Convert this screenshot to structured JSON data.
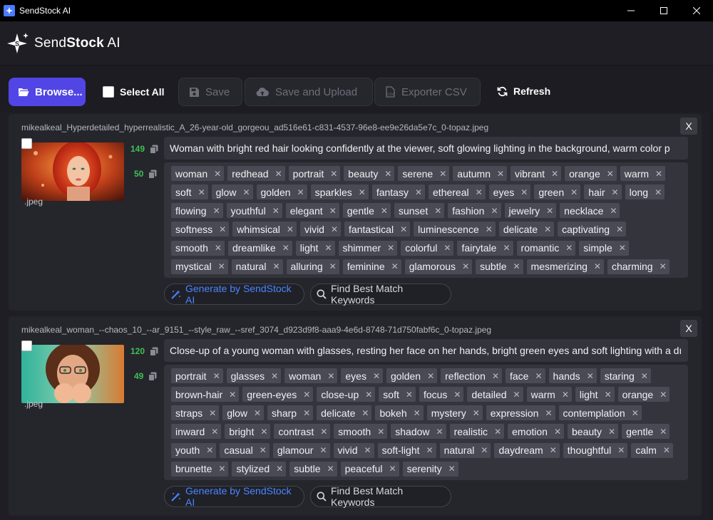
{
  "window": {
    "title": "SendStock AI"
  },
  "header": {
    "logo_light": "Send",
    "logo_bold": "Stock",
    "logo_suffix": " AI"
  },
  "toolbar": {
    "browse_label": "Browse...",
    "select_all_label": "Select All",
    "save_label": "Save",
    "save_upload_label": "Save and Upload",
    "export_csv_label": "Exporter CSV",
    "refresh_label": "Refresh"
  },
  "actions": {
    "generate_label": "Generate by SendStock AI",
    "find_label": "Find Best Match Keywords"
  },
  "items": [
    {
      "filename": "mikealkeal_Hyperdetailed_hyperrealistic_A_26-year-old_gorgeou_ad516e61-c831-4537-96e8-ee9e26da5e7c_0-topaz.jpeg",
      "ext": ".jpeg",
      "desc_count": "149",
      "kw_count": "50",
      "description": "Woman with bright red hair looking confidently at the viewer, soft glowing lighting in the background, warm color p",
      "keywords": [
        "woman",
        "redhead",
        "portrait",
        "beauty",
        "serene",
        "autumn",
        "vibrant",
        "orange",
        "warm",
        "soft",
        "glow",
        "golden",
        "sparkles",
        "fantasy",
        "ethereal",
        "eyes",
        "green",
        "hair",
        "long",
        "flowing",
        "youthful",
        "elegant",
        "gentle",
        "sunset",
        "fashion",
        "jewelry",
        "necklace",
        "softness",
        "whimsical",
        "vivid",
        "fantastical",
        "luminescence",
        "delicate",
        "captivating",
        "smooth",
        "dreamlike",
        "light",
        "shimmer",
        "colorful",
        "fairytale",
        "romantic",
        "simple",
        "mystical",
        "natural",
        "alluring",
        "feminine",
        "glamorous",
        "subtle",
        "mesmerizing",
        "charming"
      ]
    },
    {
      "filename": "mikealkeal_woman_--chaos_10_--ar_9151_--style_raw_--sref_3074_d923d9f8-aaa9-4e6d-8748-71d750fabf6c_0-topaz.jpeg",
      "ext": ".jpeg",
      "desc_count": "120",
      "kw_count": "49",
      "description": "Close-up of a young woman with glasses, resting her face on her hands, bright green eyes and soft lighting with a dı",
      "keywords": [
        "portrait",
        "glasses",
        "woman",
        "eyes",
        "golden",
        "reflection",
        "face",
        "hands",
        "staring",
        "brown-hair",
        "green-eyes",
        "close-up",
        "soft",
        "focus",
        "detailed",
        "warm",
        "light",
        "orange",
        "straps",
        "glow",
        "sharp",
        "delicate",
        "bokeh",
        "mystery",
        "expression",
        "contemplation",
        "inward",
        "bright",
        "contrast",
        "smooth",
        "shadow",
        "realistic",
        "emotion",
        "beauty",
        "gentle",
        "youth",
        "casual",
        "glamour",
        "vivid",
        "soft-light",
        "natural",
        "daydream",
        "thoughtful",
        "calm",
        "brunette",
        "stylized",
        "subtle",
        "peaceful",
        "serenity"
      ]
    }
  ],
  "close_symbol": "X",
  "tag_remove_symbol": "✕"
}
